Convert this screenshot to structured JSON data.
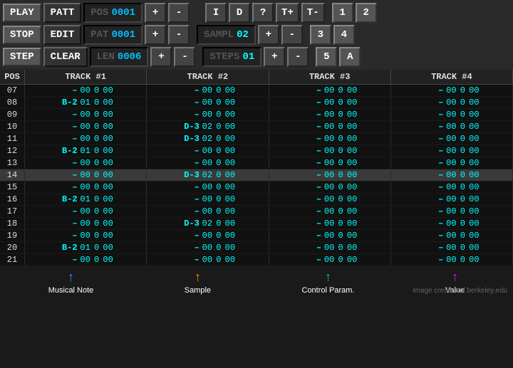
{
  "buttons": {
    "play": "PLAY",
    "stop": "STOP",
    "step": "STEP",
    "patt": "PATT",
    "edit": "EDIT",
    "clear": "CLEAR",
    "plus": "+",
    "minus": "-",
    "i": "I",
    "d": "D",
    "q": "?",
    "tplus": "T+",
    "tminus": "T-",
    "one": "1",
    "two": "2",
    "three": "3",
    "four": "4",
    "five": "5",
    "a": "A"
  },
  "displays": {
    "pos_label": "POS",
    "pos_val": "0001",
    "pat_label": "PAT",
    "pat_val": "0001",
    "len_label": "LEN",
    "len_val": "0006",
    "sampl_label": "SAMPL",
    "sampl_val": "02",
    "steps_label": "STEPS",
    "steps_val": "01"
  },
  "grid": {
    "headers": [
      "POS",
      "TRACK #1",
      "TRACK #2",
      "TRACK #3",
      "TRACK #4"
    ],
    "rows": [
      {
        "pos": "07",
        "t1": [
          "–",
          "00",
          "0",
          "00"
        ],
        "t2": [
          "–",
          "00",
          "0",
          "00"
        ],
        "t3": [
          "–",
          "00",
          "0",
          "00"
        ],
        "t4": [
          "–",
          "00",
          "0",
          "00"
        ],
        "highlight": false
      },
      {
        "pos": "08",
        "t1": [
          "B-2",
          "01",
          "0",
          "00"
        ],
        "t2": [
          "–",
          "00",
          "0",
          "00"
        ],
        "t3": [
          "–",
          "00",
          "0",
          "00"
        ],
        "t4": [
          "–",
          "00",
          "0",
          "00"
        ],
        "highlight": false
      },
      {
        "pos": "09",
        "t1": [
          "–",
          "00",
          "0",
          "00"
        ],
        "t2": [
          "–",
          "00",
          "0",
          "00"
        ],
        "t3": [
          "–",
          "00",
          "0",
          "00"
        ],
        "t4": [
          "–",
          "00",
          "0",
          "00"
        ],
        "highlight": false
      },
      {
        "pos": "10",
        "t1": [
          "–",
          "00",
          "0",
          "00"
        ],
        "t2": [
          "D-3",
          "02",
          "0",
          "00"
        ],
        "t3": [
          "–",
          "00",
          "0",
          "00"
        ],
        "t4": [
          "–",
          "00",
          "0",
          "00"
        ],
        "highlight": false
      },
      {
        "pos": "11",
        "t1": [
          "–",
          "00",
          "0",
          "00"
        ],
        "t2": [
          "D-3",
          "02",
          "0",
          "00"
        ],
        "t3": [
          "–",
          "00",
          "0",
          "00"
        ],
        "t4": [
          "–",
          "00",
          "0",
          "00"
        ],
        "highlight": false
      },
      {
        "pos": "12",
        "t1": [
          "B-2",
          "01",
          "0",
          "00"
        ],
        "t2": [
          "–",
          "00",
          "0",
          "00"
        ],
        "t3": [
          "–",
          "00",
          "0",
          "00"
        ],
        "t4": [
          "–",
          "00",
          "0",
          "00"
        ],
        "highlight": false
      },
      {
        "pos": "13",
        "t1": [
          "–",
          "00",
          "0",
          "00"
        ],
        "t2": [
          "–",
          "00",
          "0",
          "00"
        ],
        "t3": [
          "–",
          "00",
          "0",
          "00"
        ],
        "t4": [
          "–",
          "00",
          "0",
          "00"
        ],
        "highlight": false
      },
      {
        "pos": "14",
        "t1": [
          "–",
          "00",
          "0",
          "00"
        ],
        "t2": [
          "D-3",
          "02",
          "0",
          "00"
        ],
        "t3": [
          "–",
          "00",
          "0",
          "00"
        ],
        "t4": [
          "–",
          "00",
          "0",
          "00"
        ],
        "highlight": true
      },
      {
        "pos": "15",
        "t1": [
          "–",
          "00",
          "0",
          "00"
        ],
        "t2": [
          "–",
          "00",
          "0",
          "00"
        ],
        "t3": [
          "–",
          "00",
          "0",
          "00"
        ],
        "t4": [
          "–",
          "00",
          "0",
          "00"
        ],
        "highlight": false
      },
      {
        "pos": "16",
        "t1": [
          "B-2",
          "01",
          "0",
          "00"
        ],
        "t2": [
          "–",
          "00",
          "0",
          "00"
        ],
        "t3": [
          "–",
          "00",
          "0",
          "00"
        ],
        "t4": [
          "–",
          "00",
          "0",
          "00"
        ],
        "highlight": false
      },
      {
        "pos": "17",
        "t1": [
          "–",
          "00",
          "0",
          "00"
        ],
        "t2": [
          "–",
          "00",
          "0",
          "00"
        ],
        "t3": [
          "–",
          "00",
          "0",
          "00"
        ],
        "t4": [
          "–",
          "00",
          "0",
          "00"
        ],
        "highlight": false
      },
      {
        "pos": "18",
        "t1": [
          "–",
          "00",
          "0",
          "00"
        ],
        "t2": [
          "D-3",
          "02",
          "0",
          "00"
        ],
        "t3": [
          "–",
          "00",
          "0",
          "00"
        ],
        "t4": [
          "–",
          "00",
          "0",
          "00"
        ],
        "highlight": false
      },
      {
        "pos": "19",
        "t1": [
          "–",
          "00",
          "0",
          "00"
        ],
        "t2": [
          "–",
          "00",
          "0",
          "00"
        ],
        "t3": [
          "–",
          "00",
          "0",
          "00"
        ],
        "t4": [
          "–",
          "00",
          "0",
          "00"
        ],
        "highlight": false
      },
      {
        "pos": "20",
        "t1": [
          "B-2",
          "01",
          "0",
          "00"
        ],
        "t2": [
          "–",
          "00",
          "0",
          "00"
        ],
        "t3": [
          "–",
          "00",
          "0",
          "00"
        ],
        "t4": [
          "–",
          "00",
          "0",
          "00"
        ],
        "highlight": false
      },
      {
        "pos": "21",
        "t1": [
          "–",
          "00",
          "0",
          "00"
        ],
        "t2": [
          "–",
          "00",
          "0",
          "00"
        ],
        "t3": [
          "–",
          "00",
          "0",
          "00"
        ],
        "t4": [
          "–",
          "00",
          "0",
          "00"
        ],
        "highlight": false
      }
    ]
  },
  "legend": {
    "items": [
      {
        "label": "Musical  Note",
        "color": "blue"
      },
      {
        "label": "Sample",
        "color": "orange"
      },
      {
        "label": "Control Param.",
        "color": "green"
      },
      {
        "label": "Value",
        "color": "magenta"
      }
    ]
  },
  "credit": "image credit: ocf.berkeley.edu"
}
